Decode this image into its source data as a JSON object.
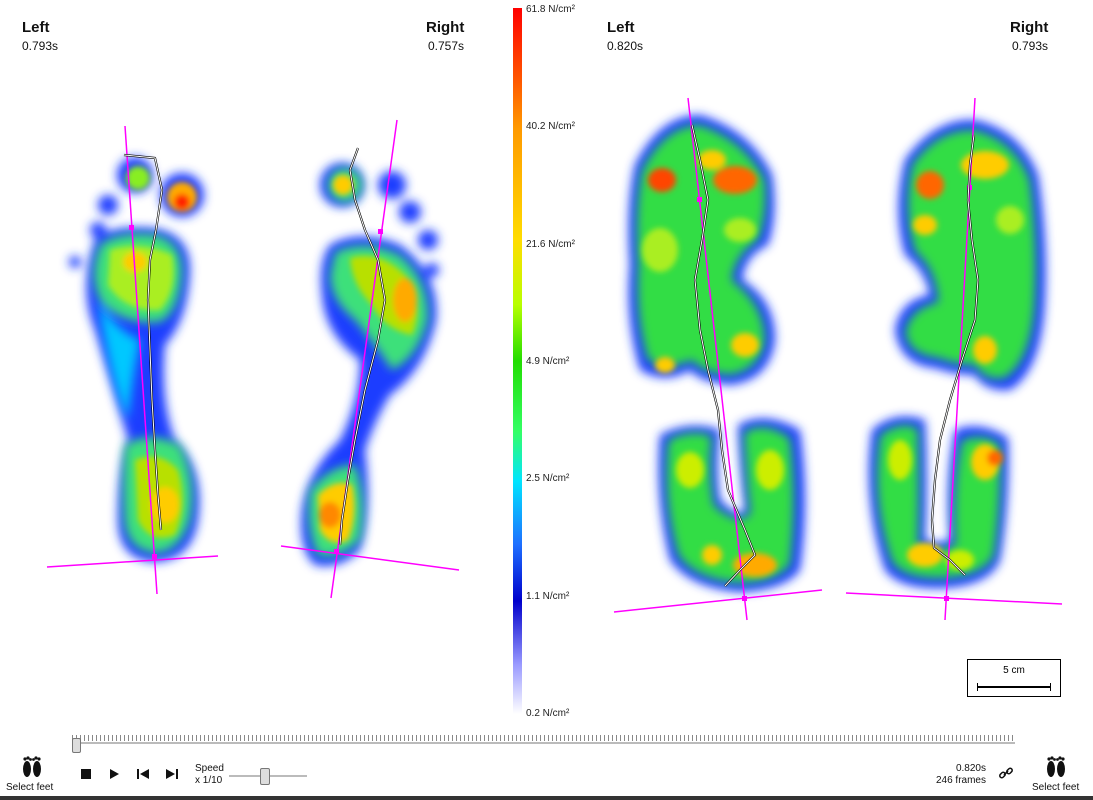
{
  "panels": [
    {
      "left_name": "Left",
      "left_time": "0.793s",
      "right_name": "Right",
      "right_time": "0.757s"
    },
    {
      "left_name": "Left",
      "left_time": "0.820s",
      "right_name": "Right",
      "right_time": "0.793s"
    }
  ],
  "scale": {
    "labels": [
      "61.8 N/cm²",
      "40.2 N/cm²",
      "21.6 N/cm²",
      "4.9 N/cm²",
      "2.5 N/cm²",
      "1.1 N/cm²",
      "0.2 N/cm²"
    ]
  },
  "scalebar_label": "5 cm",
  "controls": {
    "select_feet_left": "Select feet",
    "select_feet_right": "Select feet",
    "speed_label": "Speed",
    "speed_value": "x 1/10",
    "current_time": "0.820s",
    "frames": "246 frames"
  },
  "playback": {
    "position_fraction": 0.0,
    "speed_fraction": 0.45
  },
  "colors": {
    "axis_line": "#ff00ff",
    "trace": "#ffffff"
  },
  "icons": [
    "feet-icon",
    "stop-icon",
    "play-icon",
    "skip-back-icon",
    "skip-forward-icon",
    "link-icon"
  ]
}
